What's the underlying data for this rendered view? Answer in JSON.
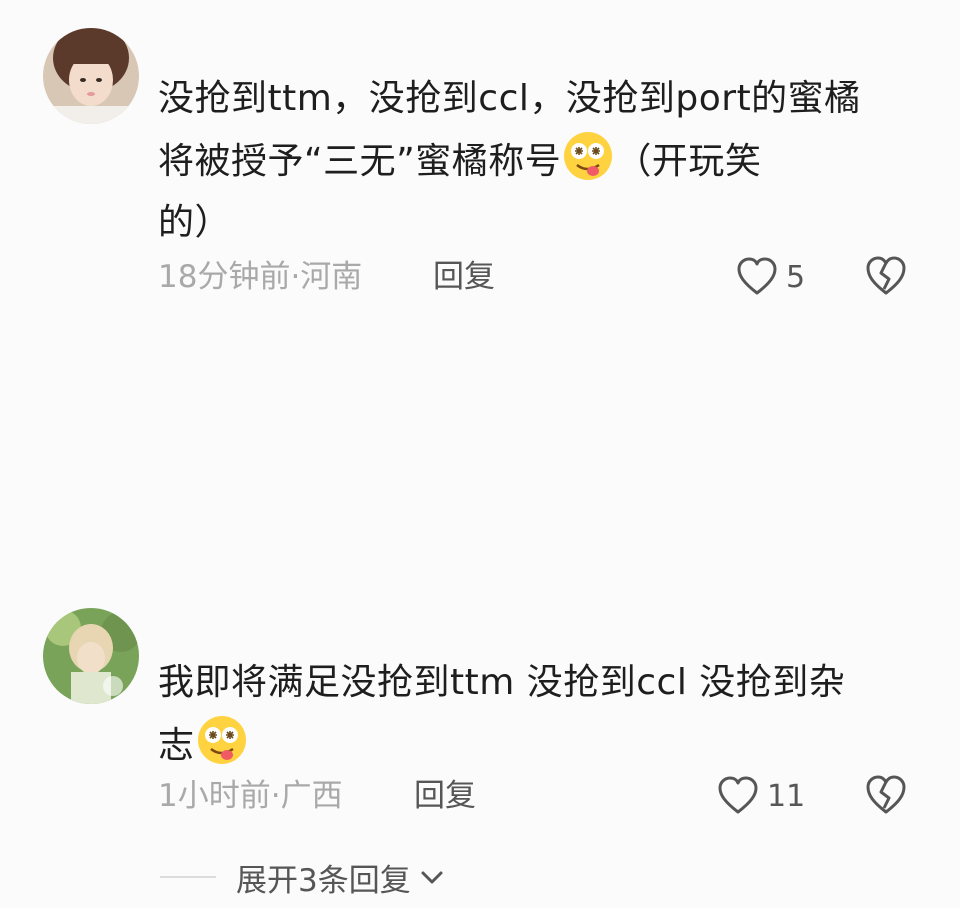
{
  "comments": [
    {
      "avatar_icon": "user-avatar-girl-icon",
      "text_line1": "没抢到ttm，没抢到ccl，没抢到port的蜜橘",
      "text_line2": "将被授予“三无”蜜橘称号",
      "text_line2_after_emoji": "（开玩笑",
      "text_line3": "的）",
      "emoji": "drooling-face-emoji",
      "meta": "18分钟前·河南",
      "reply_label": "回复",
      "like_count": "5",
      "like_icon": "heart-outline-icon",
      "dislike_icon": "broken-heart-icon"
    },
    {
      "avatar_icon": "user-avatar-garden-icon",
      "text_line1": "我即将满足没抢到ttm 没抢到ccl 没抢到杂",
      "text_line2": "志",
      "emoji": "drooling-face-emoji",
      "meta": "1小时前·广西",
      "reply_label": "回复",
      "like_count": "11",
      "like_icon": "heart-outline-icon",
      "dislike_icon": "broken-heart-icon"
    }
  ],
  "expand_replies": {
    "label": "展开3条回复",
    "icon": "chevron-down-icon"
  },
  "colors": {
    "text": "#1e1e1e",
    "meta": "#a9a9a9",
    "action": "#565656",
    "background": "#fbfbfb"
  }
}
